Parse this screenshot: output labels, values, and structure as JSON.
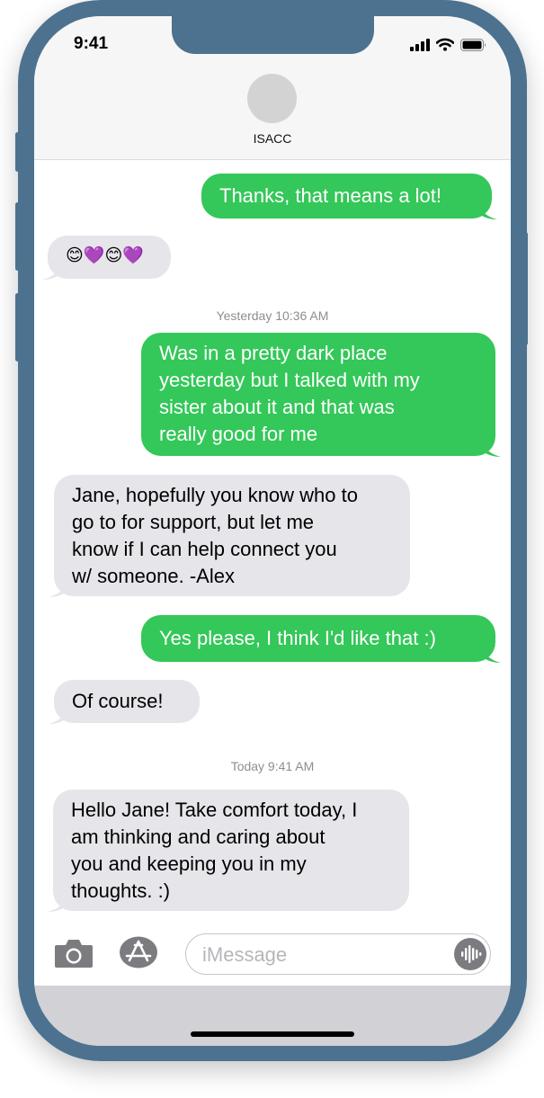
{
  "status_bar": {
    "time": "9:41"
  },
  "contact": {
    "name": "ISACC"
  },
  "messages": [
    {
      "direction": "outgoing",
      "text": "Thanks, that means a lot!"
    },
    {
      "direction": "incoming",
      "text": "😊💜😊💜"
    },
    {
      "type": "timestamp",
      "text": "Yesterday 10:36 AM"
    },
    {
      "direction": "outgoing",
      "lines": [
        "Was in a pretty dark place",
        "yesterday but I talked with my",
        "sister about it and that was",
        "really good for me"
      ]
    },
    {
      "direction": "incoming",
      "lines": [
        "Jane, hopefully you know who to",
        "go to for support, but let me",
        "know if I can help connect you",
        "w/ someone. -Alex"
      ]
    },
    {
      "direction": "outgoing",
      "text": "Yes please, I think I'd like that :)"
    },
    {
      "direction": "incoming",
      "text": "Of course!"
    },
    {
      "type": "timestamp",
      "text": "Today 9:41 AM"
    },
    {
      "direction": "incoming",
      "lines": [
        "Hello Jane! Take comfort today, I",
        "am thinking and caring about",
        "you and keeping you in my",
        "thoughts.  :)"
      ]
    }
  ],
  "input": {
    "placeholder": "iMessage"
  },
  "icons": {
    "camera": "camera-icon",
    "apps": "app-store-icon",
    "audio": "audio-waveform-icon",
    "signal": "cellular-signal-icon",
    "wifi": "wifi-icon",
    "battery": "battery-icon"
  },
  "colors": {
    "frame": "#4d7290",
    "outgoing_bubble": "#34c759",
    "incoming_bubble": "#e5e5ea"
  }
}
